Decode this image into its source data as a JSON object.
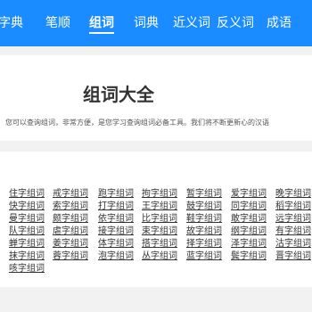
{
  "nav": {
    "items": [
      "字典",
      "笔顺",
      "组词",
      "词典",
      "近义词",
      "反义词",
      "成语"
    ],
    "active_index": 2
  },
  "header": {
    "title": "组词大全",
    "intro": "您可以查询组词，非常方便，是您学习查询组词必备工具。我们将不断更新心的汉语"
  },
  "words": [
    [
      "住字组词",
      "戒字组词",
      "跑字组词",
      "拘字组词",
      "暂字组词",
      "爱字组词",
      "晚字组词"
    ],
    [
      "快字组词",
      "索字组词",
      "打字组词",
      "王字组词",
      "鼓字组词",
      "同字组词",
      "稻字组词"
    ],
    [
      "曼字组词",
      "颇字组词",
      "依字组词",
      "比字组词",
      "鞋字组词",
      "敢字组词",
      "远字组词"
    ],
    [
      "队字组词",
      "虐字组词",
      "接字组词",
      "束字组词",
      "故字组词",
      "纲字组词",
      "有字组词"
    ],
    [
      "蝉字组词",
      "姜字组词",
      "体字组词",
      "搭字组词",
      "择字组词",
      "泽字组词",
      "沽字组词"
    ],
    [
      "抹字组词",
      "蓉字组词",
      "泡字组词",
      "丛字组词",
      "蓝字组词",
      "鬓字组词",
      "晋字组词"
    ],
    [
      "咳字组词"
    ]
  ],
  "colors": {
    "nav_bg": "#1a8cff",
    "page_bg": "#f2f2f2",
    "panel_bg": "#ffffff"
  }
}
